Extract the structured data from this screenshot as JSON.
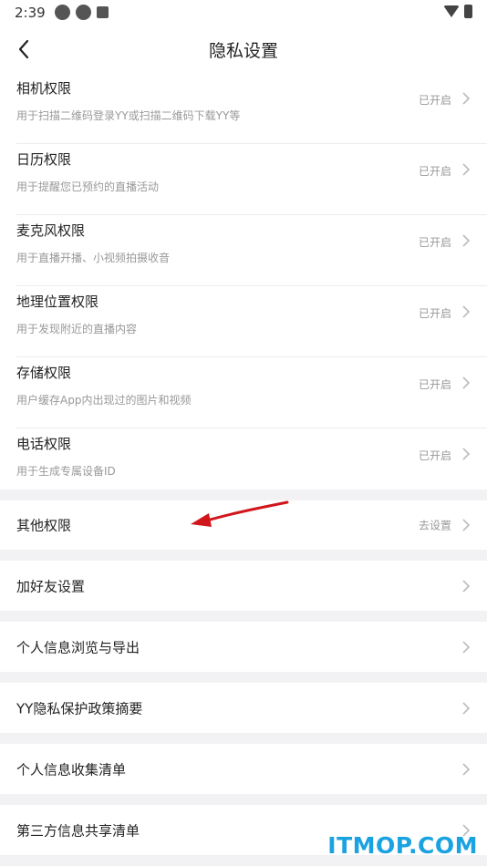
{
  "status_bar": {
    "time": "2:39"
  },
  "header": {
    "title": "隐私设置"
  },
  "permissions": [
    {
      "title": "相机权限",
      "desc": "用于扫描二维码登录YY或扫描二维码下载YY等",
      "status": "已开启"
    },
    {
      "title": "日历权限",
      "desc": "用于提醒您已预约的直播活动",
      "status": "已开启"
    },
    {
      "title": "麦克风权限",
      "desc": "用于直播开播、小视频拍摄收音",
      "status": "已开启"
    },
    {
      "title": "地理位置权限",
      "desc": "用于发现附近的直播内容",
      "status": "已开启"
    },
    {
      "title": "存储权限",
      "desc": "用户缓存App内出现过的图片和视频",
      "status": "已开启"
    },
    {
      "title": "电话权限",
      "desc": "用于生成专属设备ID",
      "status": "已开启"
    }
  ],
  "other_permissions": {
    "title": "其他权限",
    "status": "去设置"
  },
  "menu": [
    {
      "title": "加好友设置"
    },
    {
      "title": "个人信息浏览与导出"
    },
    {
      "title": "YY隐私保护政策摘要"
    },
    {
      "title": "个人信息收集清单"
    },
    {
      "title": "第三方信息共享清单"
    }
  ],
  "watermark": "ITMOP.COM",
  "colors": {
    "background": "#f2f2f4",
    "secondary_text": "#999999",
    "annotation_arrow": "#d0161b",
    "watermark": "#1aa3e0"
  },
  "icons": {
    "back": "chevron-left-icon",
    "row_arrow": "chevron-right-icon"
  }
}
